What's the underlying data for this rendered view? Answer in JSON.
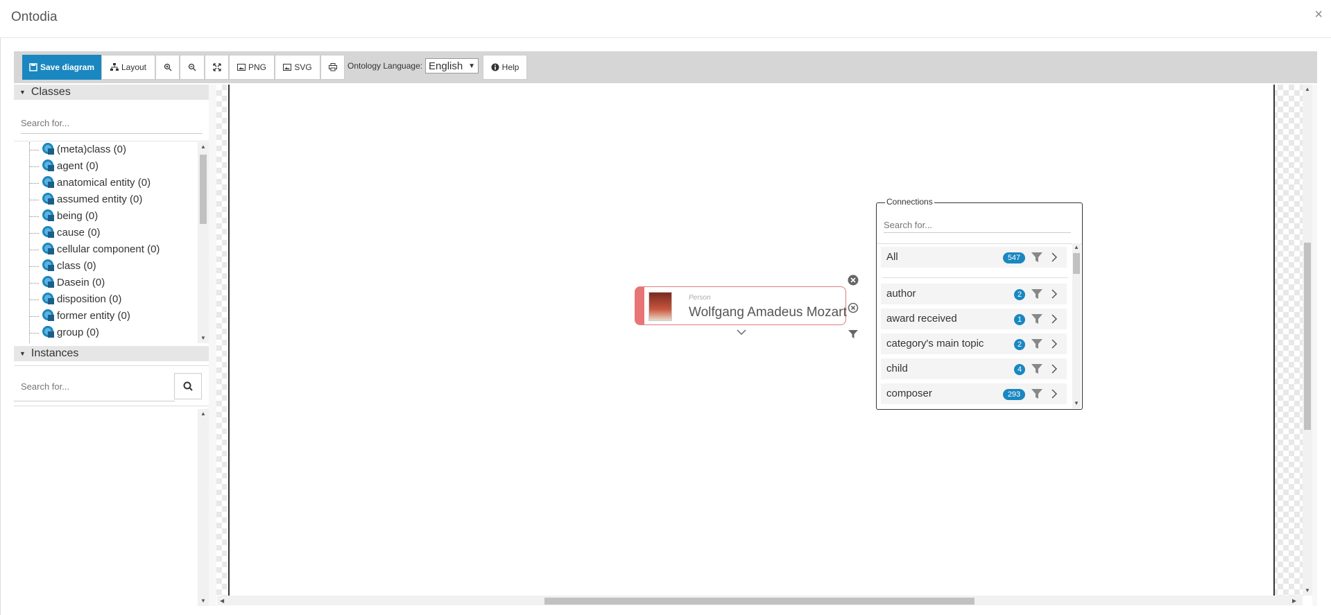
{
  "app": {
    "title": "Ontodia",
    "close_label": "×"
  },
  "toolbar": {
    "save_label": "Save diagram",
    "layout_label": "Layout",
    "png_label": "PNG",
    "svg_label": "SVG",
    "language_label": "Ontology Language:",
    "language_value": "English",
    "help_label": "Help"
  },
  "classes": {
    "header": "Classes",
    "search_placeholder": "Search for...",
    "items": [
      {
        "label": "(meta)class (0)"
      },
      {
        "label": "agent (0)"
      },
      {
        "label": "anatomical entity (0)"
      },
      {
        "label": "assumed entity (0)"
      },
      {
        "label": "being (0)"
      },
      {
        "label": "cause (0)"
      },
      {
        "label": "cellular component (0)"
      },
      {
        "label": "class (0)"
      },
      {
        "label": "Dasein (0)"
      },
      {
        "label": "disposition (0)"
      },
      {
        "label": "former entity (0)"
      },
      {
        "label": "group (0)"
      }
    ]
  },
  "instances": {
    "header": "Instances",
    "search_placeholder": "Search for..."
  },
  "node": {
    "type": "Person",
    "name": "Wolfgang Amadeus Mozart",
    "accent": "#e87575"
  },
  "connections": {
    "title": "Connections",
    "search_placeholder": "Search for...",
    "all": {
      "label": "All",
      "count": "547"
    },
    "items": [
      {
        "label": "author",
        "count": "2"
      },
      {
        "label": "award received",
        "count": "1"
      },
      {
        "label": "category's main topic",
        "count": "2"
      },
      {
        "label": "child",
        "count": "4"
      },
      {
        "label": "composer",
        "count": "293"
      }
    ]
  },
  "colors": {
    "primary": "#1a87c0",
    "toolbar_bg": "#d6d6d6"
  }
}
